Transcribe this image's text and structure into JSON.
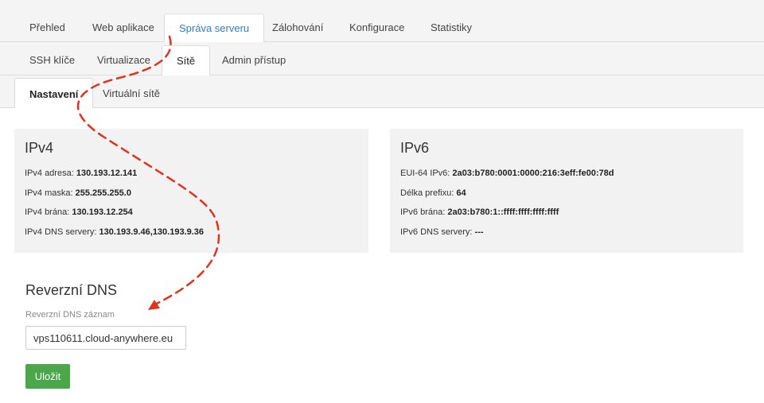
{
  "tabs_main": [
    {
      "label": "Přehled"
    },
    {
      "label": "Web aplikace"
    },
    {
      "label": "Správa serveru"
    },
    {
      "label": "Zálohování"
    },
    {
      "label": "Konfigurace"
    },
    {
      "label": "Statistiky"
    }
  ],
  "tabs_sub": [
    {
      "label": "SSH klíče"
    },
    {
      "label": "Virtualizace"
    },
    {
      "label": "Sítě"
    },
    {
      "label": "Admin přístup"
    }
  ],
  "tabs_network": [
    {
      "label": "Nastavení"
    },
    {
      "label": "Virtuální sítě"
    }
  ],
  "ipv4": {
    "title": "IPv4",
    "rows": [
      {
        "label": "IPv4 adresa:",
        "value": "130.193.12.141"
      },
      {
        "label": "IPv4 maska:",
        "value": "255.255.255.0"
      },
      {
        "label": "IPv4 brána:",
        "value": "130.193.12.254"
      },
      {
        "label": "IPv4 DNS servery:",
        "value": "130.193.9.46,130.193.9.36"
      }
    ]
  },
  "ipv6": {
    "title": "IPv6",
    "rows": [
      {
        "label": "EUI-64 IPv6:",
        "value": "2a03:b780:0001:0000:216:3eff:fe00:78d"
      },
      {
        "label": "Délka prefixu:",
        "value": "64"
      },
      {
        "label": "IPv6 brána:",
        "value": "2a03:b780:1::ffff:ffff:ffff:ffff"
      },
      {
        "label": "IPv6 DNS servery:",
        "value": "---"
      }
    ]
  },
  "rdns": {
    "title": "Reverzní DNS",
    "field_label": "Reverzní DNS záznam",
    "value": "vps110611.cloud-anywhere.eu",
    "save_label": "Uložit"
  },
  "colors": {
    "active_tab_text": "#2e7fc6",
    "save_button": "#4aa84a",
    "annotation_arrow": "#e0321e"
  }
}
